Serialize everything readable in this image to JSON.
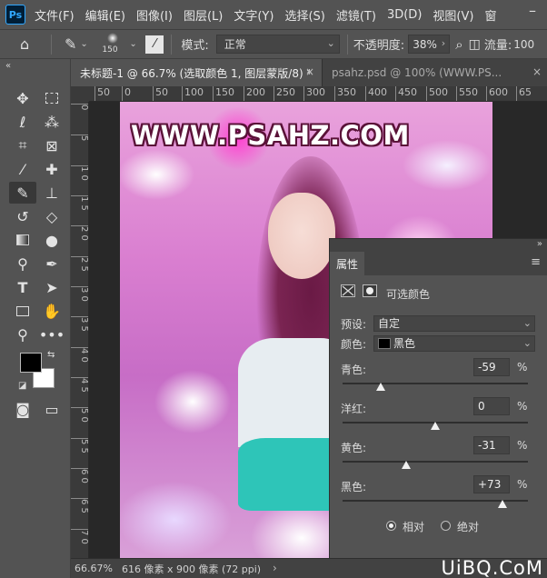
{
  "app": {
    "logo_text": "Ps"
  },
  "menu": [
    "文件(F)",
    "编辑(E)",
    "图像(I)",
    "图层(L)",
    "文字(Y)",
    "选择(S)",
    "滤镜(T)",
    "3D(D)",
    "视图(V)",
    "窗"
  ],
  "options_bar": {
    "brush_size": "150",
    "mode_label": "模式:",
    "mode_value": "正常",
    "opacity_label": "不透明度:",
    "opacity_value": "38%",
    "flow_label": "流量:",
    "flow_value": "100"
  },
  "tabs": [
    {
      "label": "未标题-1 @ 66.7% (选取颜色 1, 图层蒙版/8) *",
      "close": "×"
    },
    {
      "label": "psahz.psd @ 100% (WWW.PS...",
      "close": "×"
    }
  ],
  "ruler_h": [
    "50",
    "0",
    "50",
    "100",
    "150",
    "200",
    "250",
    "300",
    "350",
    "400",
    "450",
    "500",
    "550",
    "600",
    "65"
  ],
  "ruler_v": [
    "0",
    "5",
    "1 0",
    "1 5",
    "2 0",
    "2 5",
    "3 0",
    "3 5",
    "4 0",
    "4 5",
    "5 0",
    "5 5",
    "6 0",
    "6 5",
    "7 0"
  ],
  "canvas": {
    "watermark": "WWW.PSAHZ.COM"
  },
  "status": {
    "zoom": "66.67%",
    "doc_info": "616 像素 x 900 像素 (72 ppi)",
    "arrow": "›",
    "site_badge": "UiBQ.CoM"
  },
  "properties": {
    "tab_label": "属性",
    "menu_icon": "≡",
    "adjustment_name": "可选颜色",
    "preset_label": "预设:",
    "preset_value": "自定",
    "colors_label": "颜色:",
    "colors_value": "黑色",
    "sliders": [
      {
        "label": "青色:",
        "value": "-59",
        "unit": "%",
        "fraction": 0.205
      },
      {
        "label": "洋红:",
        "value": "0",
        "unit": "%",
        "fraction": 0.5
      },
      {
        "label": "黄色:",
        "value": "-31",
        "unit": "%",
        "fraction": 0.345
      },
      {
        "label": "黑色:",
        "value": "+73",
        "unit": "%",
        "fraction": 0.865
      }
    ],
    "method_relative": "相对",
    "method_absolute": "绝对",
    "method_selected": "relative"
  }
}
